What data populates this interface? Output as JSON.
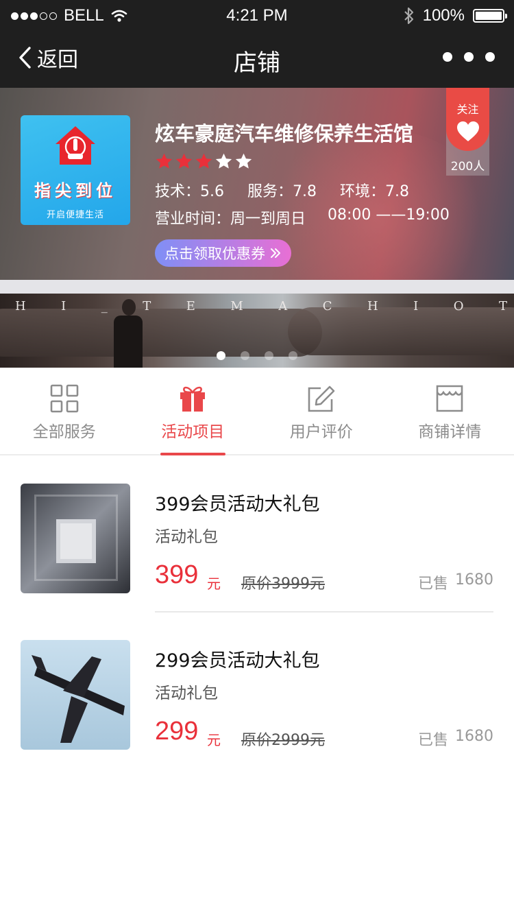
{
  "status_bar": {
    "carrier": "BELL",
    "time": "4:21 PM",
    "battery": "100%",
    "battery_level": 1.0
  },
  "nav": {
    "back_label": "返回",
    "title": "店铺"
  },
  "shop": {
    "logo_title": "指尖到位",
    "logo_subtitle": "开启便捷生活",
    "name": "炫车豪庭汽车维修保养生活馆",
    "rating": 3,
    "rating_max": 5,
    "scores": [
      {
        "label": "技术：5.6"
      },
      {
        "label": "服务：7.8"
      },
      {
        "label": "环境：7.8"
      }
    ],
    "hours_label": "营业时间：周一到周日",
    "hours_value": "08:00 ——19:00",
    "coupon_label": "点击领取优惠券",
    "follow_label": "关注",
    "follow_count": "200人"
  },
  "banner": {
    "letters": [
      "H",
      "I",
      "_",
      "T",
      "E",
      "M",
      "A",
      "C",
      "H",
      "I",
      "O",
      "T"
    ],
    "slide_count": 4,
    "active_slide": 0
  },
  "tabs": [
    {
      "label": "全部服务",
      "icon": "grid-icon",
      "active": false
    },
    {
      "label": "活动项目",
      "icon": "gift-icon",
      "active": true
    },
    {
      "label": "用户评价",
      "icon": "edit-icon",
      "active": false
    },
    {
      "label": "商铺详情",
      "icon": "store-icon",
      "active": false
    }
  ],
  "products": [
    {
      "title": "399会员活动大礼包",
      "subtitle": "活动礼包",
      "price": "399",
      "unit": "元",
      "original_price": "原价3999元",
      "sold_label": "已售",
      "sold_count": "1680"
    },
    {
      "title": "299会员活动大礼包",
      "subtitle": "活动礼包",
      "price": "299",
      "unit": "元",
      "original_price": "原价2999元",
      "sold_label": "已售",
      "sold_count": "1680"
    }
  ],
  "colors": {
    "accent": "#e9474a",
    "price": "#e9303a",
    "nav_bg": "#1f1f1f"
  }
}
